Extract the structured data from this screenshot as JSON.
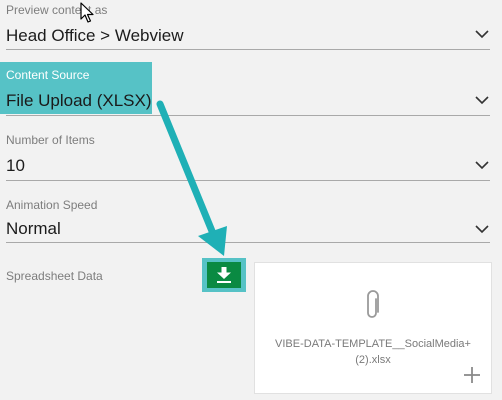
{
  "preview": {
    "label": "Preview content as",
    "value": "Head Office > Webview"
  },
  "content_source": {
    "label": "Content Source",
    "value": "File Upload (XLSX)"
  },
  "number_of_items": {
    "label": "Number of Items",
    "value": "10"
  },
  "animation_speed": {
    "label": "Animation Speed",
    "value": "Normal"
  },
  "spreadsheet": {
    "label": "Spreadsheet Data",
    "download_icon": "download-icon",
    "file_name_line1": "VIBE-DATA-TEMPLATE__SocialMedia+",
    "file_name_line2": "(2).xlsx",
    "attachment_icon": "paperclip-icon",
    "add_icon": "plus-icon"
  },
  "colors": {
    "highlight": "#56c2c6",
    "download_button": "#0a8a42",
    "annotation_arrow": "#1fb0b6"
  }
}
